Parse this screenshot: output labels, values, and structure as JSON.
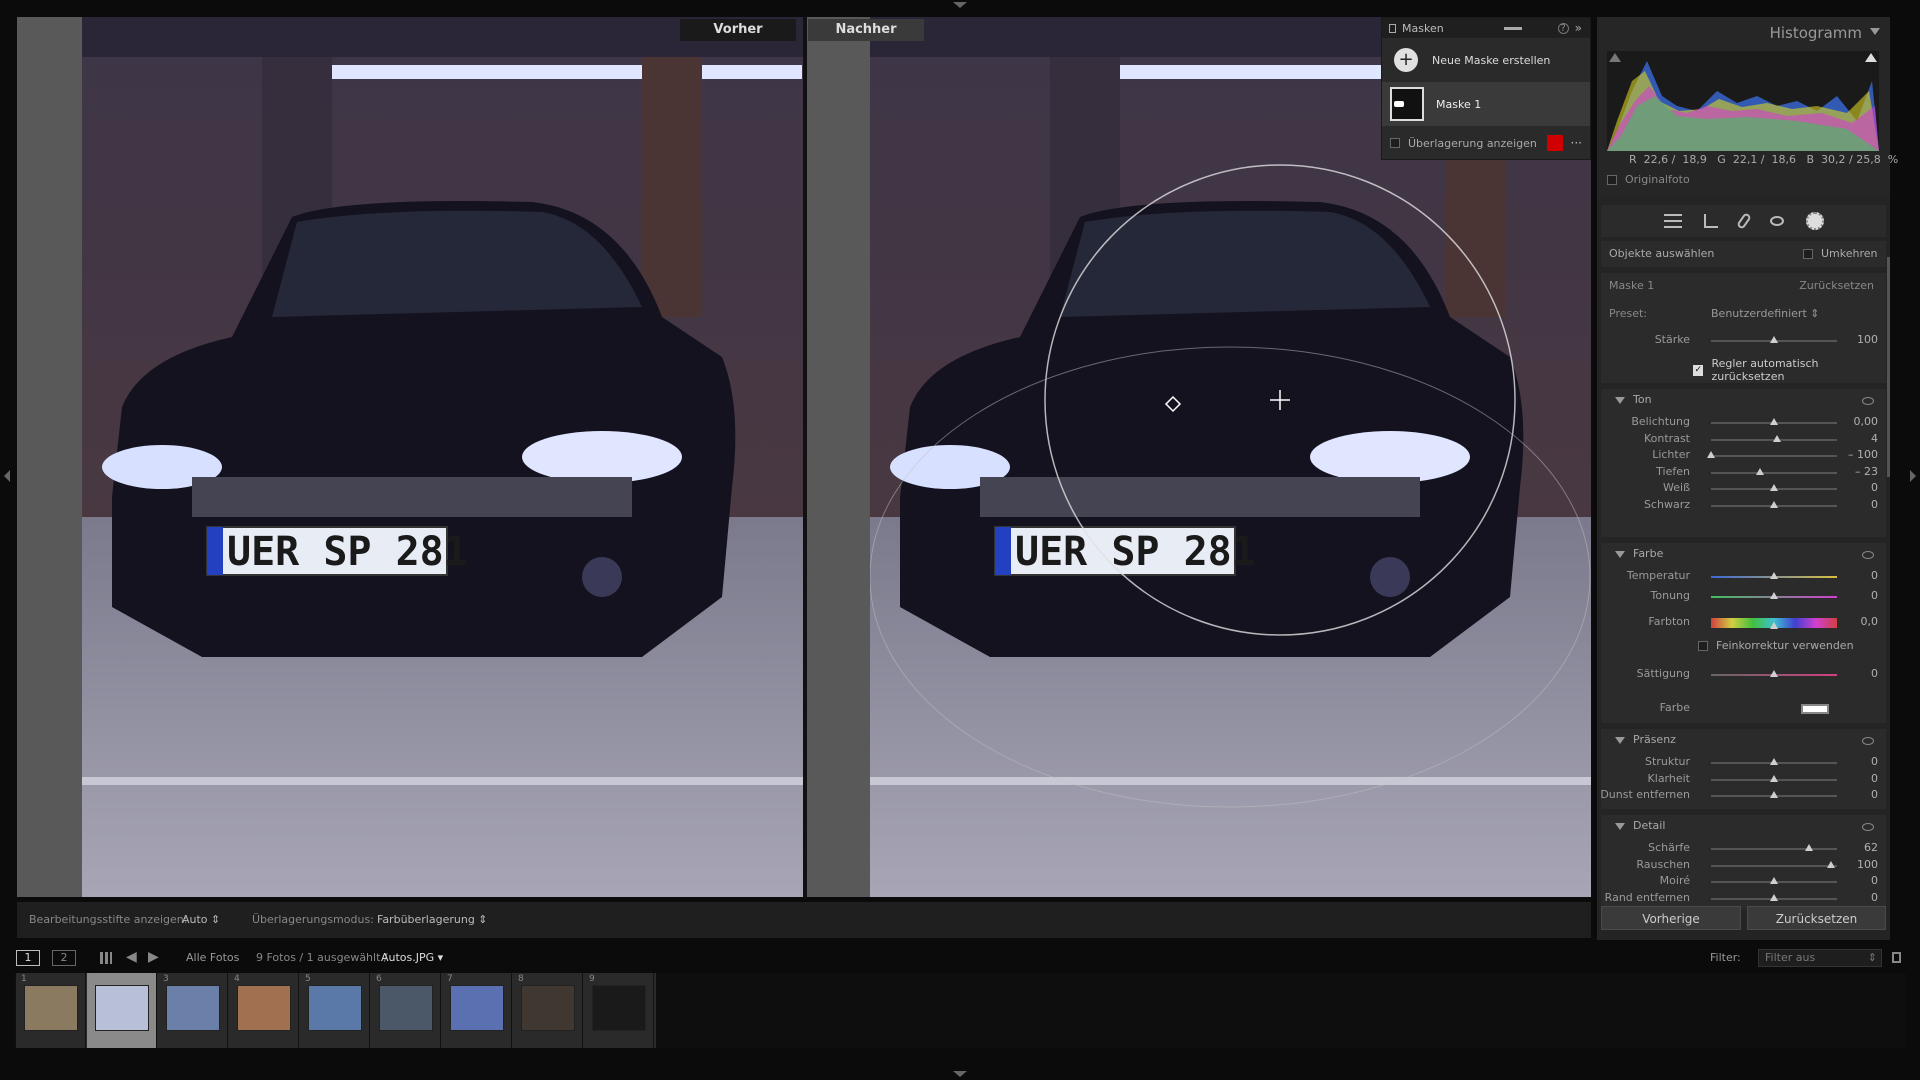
{
  "viewer": {
    "before_label": "Vorher",
    "after_label": "Nachher",
    "plate_text": "UER SP 281"
  },
  "masks_panel": {
    "title": "Masken",
    "new_mask": "Neue Maske erstellen",
    "mask_name": "Maske 1",
    "overlay_label": "Überlagerung anzeigen",
    "overlay_color": "#d00000"
  },
  "histogram": {
    "title": "Histogramm",
    "readout": "R  22,6 /  18,9   G  22,1 /  18,6   B  30,2 / 25,8  %",
    "original_label": "Originalfoto"
  },
  "select_objects": {
    "label": "Objekte auswählen",
    "invert": "Umkehren"
  },
  "mask_settings": {
    "mask_name": "Maske 1",
    "reset": "Zurücksetzen",
    "preset_label": "Preset:",
    "preset_value": "Benutzerdefiniert",
    "strength_label": "Stärke",
    "strength_value": "100",
    "strength_pos": 0.5,
    "auto_reset_label": "Regler automatisch zurücksetzen"
  },
  "tone": {
    "title": "Ton",
    "sliders": [
      {
        "label": "Belichtung",
        "value": "0,00",
        "pos": 0.5
      },
      {
        "label": "Kontrast",
        "value": "4",
        "pos": 0.52
      },
      {
        "label": "Lichter",
        "value": "– 100",
        "pos": 0.0
      },
      {
        "label": "Tiefen",
        "value": "– 23",
        "pos": 0.39
      },
      {
        "label": "Weiß",
        "value": "0",
        "pos": 0.5
      },
      {
        "label": "Schwarz",
        "value": "0",
        "pos": 0.5
      }
    ]
  },
  "color": {
    "title": "Farbe",
    "temperature": {
      "label": "Temperatur",
      "value": "0",
      "pos": 0.5
    },
    "tint": {
      "label": "Tonung",
      "value": "0",
      "pos": 0.5
    },
    "hue": {
      "label": "Farbton",
      "value": "0,0",
      "pos": 0.5
    },
    "fine_label": "Feinkorrektur verwenden",
    "saturation": {
      "label": "Sättigung",
      "value": "0",
      "pos": 0.5
    },
    "color_label": "Farbe"
  },
  "presence": {
    "title": "Präsenz",
    "sliders": [
      {
        "label": "Struktur",
        "value": "0",
        "pos": 0.5
      },
      {
        "label": "Klarheit",
        "value": "0",
        "pos": 0.5
      },
      {
        "label": "Dunst entfernen",
        "value": "0",
        "pos": 0.5
      }
    ]
  },
  "detail": {
    "title": "Detail",
    "sliders": [
      {
        "label": "Schärfe",
        "value": "62",
        "pos": 0.78
      },
      {
        "label": "Rauschen",
        "value": "100",
        "pos": 0.95
      },
      {
        "label": "Moiré",
        "value": "0",
        "pos": 0.5
      },
      {
        "label": "Rand entfernen",
        "value": "0",
        "pos": 0.5
      }
    ]
  },
  "bottom_buttons": {
    "previous": "Vorherige",
    "reset": "Zurücksetzen"
  },
  "toolbar": {
    "pins_label": "Bearbeitungsstifte anzeigen:",
    "pins_value": "Auto",
    "overlay_mode_label": "Überlagerungsmodus:",
    "overlay_mode_value": "Farbüberlagerung"
  },
  "filmbar": {
    "page1": "1",
    "page2": "2",
    "source": "Alle Fotos",
    "count": "9 Fotos / 1 ausgewählt /",
    "file": "Autos.JPG",
    "filter_label": "Filter:",
    "filter_value": "Filter aus"
  },
  "thumbnails": [
    "1",
    "2",
    "3",
    "4",
    "5",
    "6",
    "7",
    "8",
    "9"
  ]
}
